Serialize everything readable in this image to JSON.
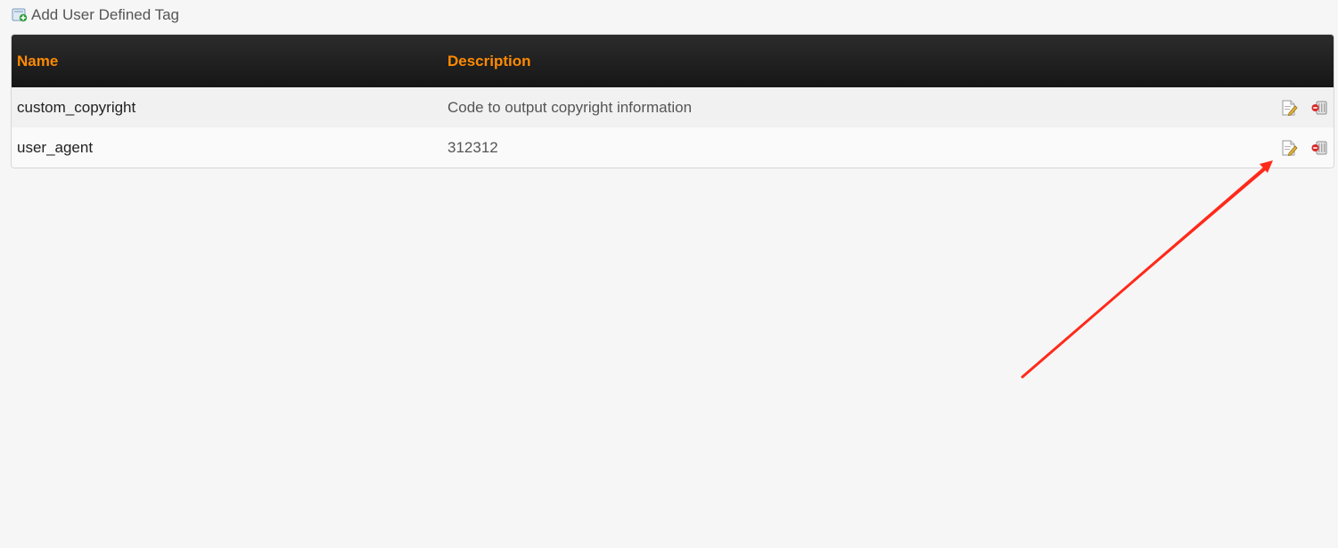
{
  "toolbar": {
    "add_label": "Add User Defined Tag",
    "add_icon": "add-tag-icon"
  },
  "table": {
    "headers": {
      "name": "Name",
      "description": "Description"
    },
    "rows": [
      {
        "name": "custom_copyright",
        "description": "Code to output copyright information",
        "actions": [
          "edit-icon",
          "delete-icon"
        ]
      },
      {
        "name": "user_agent",
        "description": "312312",
        "actions": [
          "edit-icon",
          "delete-icon"
        ]
      }
    ]
  },
  "colors": {
    "header_text": "#ff8a00",
    "header_bg": "#1e1e1e",
    "annotation_arrow": "#ff2a1a"
  }
}
